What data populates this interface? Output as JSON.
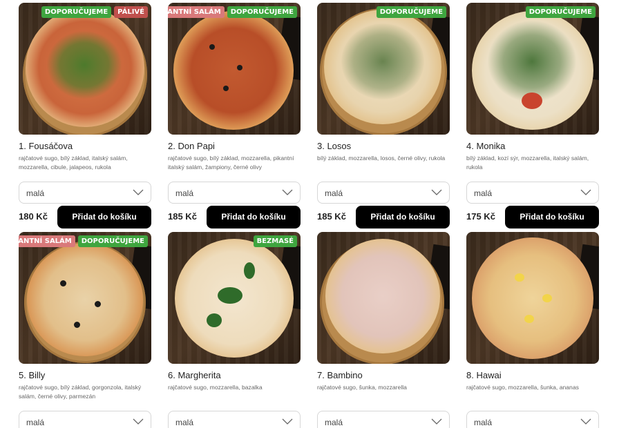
{
  "products": [
    {
      "title": "1. Fousáčova",
      "description": "rajčatové sugo, bílý základ, italský salám, mozzarella, cibule, jalapeos, rukola",
      "badges": [
        "DOPORUČUJEME",
        "PÁLIVÉ"
      ],
      "size": "malá",
      "price": "180 Kč",
      "button": "Přidat do košíku"
    },
    {
      "title": "2. Don Papi",
      "description": "rajčatové sugo, bílý základ, mozzarella, pikantní italský salám, žampiony, černé olivy",
      "badges": [
        "PIKANTNÍ SALÁM",
        "DOPORUČUJEME"
      ],
      "size": "malá",
      "price": "185 Kč",
      "button": "Přidat do košíku"
    },
    {
      "title": "3. Losos",
      "description": "bílý základ, mozzarella, losos, černé olivy, rukola",
      "badges": [
        "DOPORUČUJEME"
      ],
      "size": "malá",
      "price": "185 Kč",
      "button": "Přidat do košíku"
    },
    {
      "title": "4. Monika",
      "description": "bílý základ, kozí sýr, mozzarella, italský salám, rukola",
      "badges": [
        "DOPORUČUJEME"
      ],
      "size": "malá",
      "price": "175 Kč",
      "button": "Přidat do košíku"
    },
    {
      "title": "5. Billy",
      "description": "rajčatové sugo, bílý základ, gorgonzola, italský salám, černé olivy, parmezán",
      "badges": [
        "PIKANTNÍ SALÁM",
        "DOPORUČUJEME"
      ],
      "size": "malá"
    },
    {
      "title": "6. Margherita",
      "description": "rajčatové sugo, mozzarella, bazalka",
      "badges": [
        "BEZMASÉ"
      ],
      "size": "malá"
    },
    {
      "title": "7. Bambino",
      "description": "rajčatové sugo, šunka, mozzarella",
      "badges": [],
      "size": "malá"
    },
    {
      "title": "8. Hawai",
      "description": "rajčatové sugo, mozzarella, šunka, ananas",
      "badges": [],
      "size": "malá"
    }
  ],
  "colors": {
    "badge_recommend": "#3fa53f",
    "badge_spicy": "#c0504d",
    "badge_salami": "#d9797a",
    "button_bg": "#000000"
  },
  "icons": {
    "select_chevron": "chevron-down-icon"
  }
}
